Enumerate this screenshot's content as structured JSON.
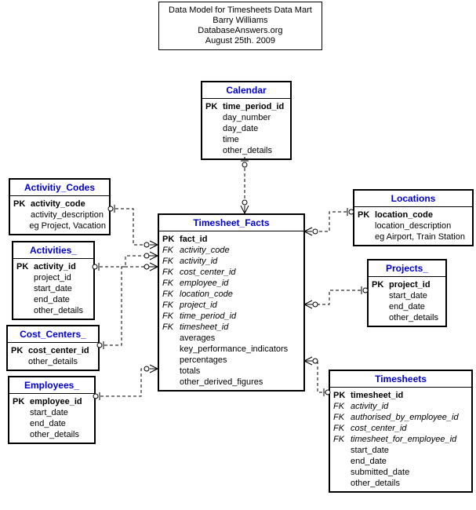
{
  "title": {
    "line1": "Data Model for Timesheets Data Mart",
    "line2": "Barry Williams",
    "line3": "DatabaseAnswers.org",
    "line4": "August 25th. 2009"
  },
  "entities": {
    "calendar": {
      "name": "Calendar",
      "rows": [
        {
          "key": "PK",
          "name": "time_period_id",
          "bold": true
        },
        {
          "key": "",
          "name": "day_number"
        },
        {
          "key": "",
          "name": "day_date"
        },
        {
          "key": "",
          "name": "time"
        },
        {
          "key": "",
          "name": "other_details"
        }
      ]
    },
    "activity_codes": {
      "name": "Activitiy_Codes",
      "rows": [
        {
          "key": "PK",
          "name": "activity_code",
          "bold": true
        },
        {
          "key": "",
          "name": "activity_description"
        },
        {
          "key": "",
          "name": "eg Project, Vacation"
        }
      ]
    },
    "activities": {
      "name": "Activities_",
      "rows": [
        {
          "key": "PK",
          "name": "activity_id",
          "bold": true
        },
        {
          "key": "",
          "name": "project_id"
        },
        {
          "key": "",
          "name": "start_date"
        },
        {
          "key": "",
          "name": "end_date"
        },
        {
          "key": "",
          "name": "other_details"
        }
      ]
    },
    "cost_centers": {
      "name": "Cost_Centers_",
      "rows": [
        {
          "key": "PK",
          "name": "cost_center_id",
          "bold": true
        },
        {
          "key": "",
          "name": "other_details"
        }
      ]
    },
    "employees": {
      "name": "Employees_",
      "rows": [
        {
          "key": "PK",
          "name": "employee_id",
          "bold": true
        },
        {
          "key": "",
          "name": "start_date"
        },
        {
          "key": "",
          "name": "end_date"
        },
        {
          "key": "",
          "name": "other_details"
        }
      ]
    },
    "timesheet_facts": {
      "name": "Timesheet_Facts",
      "rows": [
        {
          "key": "PK",
          "name": "fact_id",
          "bold": true
        },
        {
          "key": "FK",
          "name": "activity_code",
          "fk": true
        },
        {
          "key": "FK",
          "name": "activity_id",
          "fk": true
        },
        {
          "key": "FK",
          "name": "cost_center_id",
          "fk": true
        },
        {
          "key": "FK",
          "name": "employee_id",
          "fk": true
        },
        {
          "key": "FK",
          "name": "location_code",
          "fk": true
        },
        {
          "key": "FK",
          "name": "project_id",
          "fk": true
        },
        {
          "key": "FK",
          "name": "time_period_id",
          "fk": true
        },
        {
          "key": "FK",
          "name": "timesheet_id",
          "fk": true
        },
        {
          "key": "",
          "name": "averages"
        },
        {
          "key": "",
          "name": "key_performance_indicators"
        },
        {
          "key": "",
          "name": "percentages"
        },
        {
          "key": "",
          "name": "totals"
        },
        {
          "key": "",
          "name": "other_derived_figures"
        }
      ]
    },
    "locations": {
      "name": "Locations",
      "rows": [
        {
          "key": "PK",
          "name": "location_code",
          "bold": true
        },
        {
          "key": "",
          "name": "location_description"
        },
        {
          "key": "",
          "name": "eg Airport, Train Station"
        }
      ]
    },
    "projects": {
      "name": "Projects_",
      "rows": [
        {
          "key": "PK",
          "name": "project_id",
          "bold": true
        },
        {
          "key": "",
          "name": "start_date"
        },
        {
          "key": "",
          "name": "end_date"
        },
        {
          "key": "",
          "name": "other_details"
        }
      ]
    },
    "timesheets": {
      "name": "Timesheets",
      "rows": [
        {
          "key": "PK",
          "name": "timesheet_id",
          "bold": true
        },
        {
          "key": "FK",
          "name": "activity_id",
          "fk": true
        },
        {
          "key": "FK",
          "name": "authorised_by_employee_id",
          "fk": true
        },
        {
          "key": "FK",
          "name": "cost_center_id",
          "fk": true
        },
        {
          "key": "FK",
          "name": "timesheet_for_employee_id",
          "fk": true
        },
        {
          "key": "",
          "name": "start_date"
        },
        {
          "key": "",
          "name": "end_date"
        },
        {
          "key": "",
          "name": "submitted_date"
        },
        {
          "key": "",
          "name": "other_details"
        }
      ]
    }
  }
}
